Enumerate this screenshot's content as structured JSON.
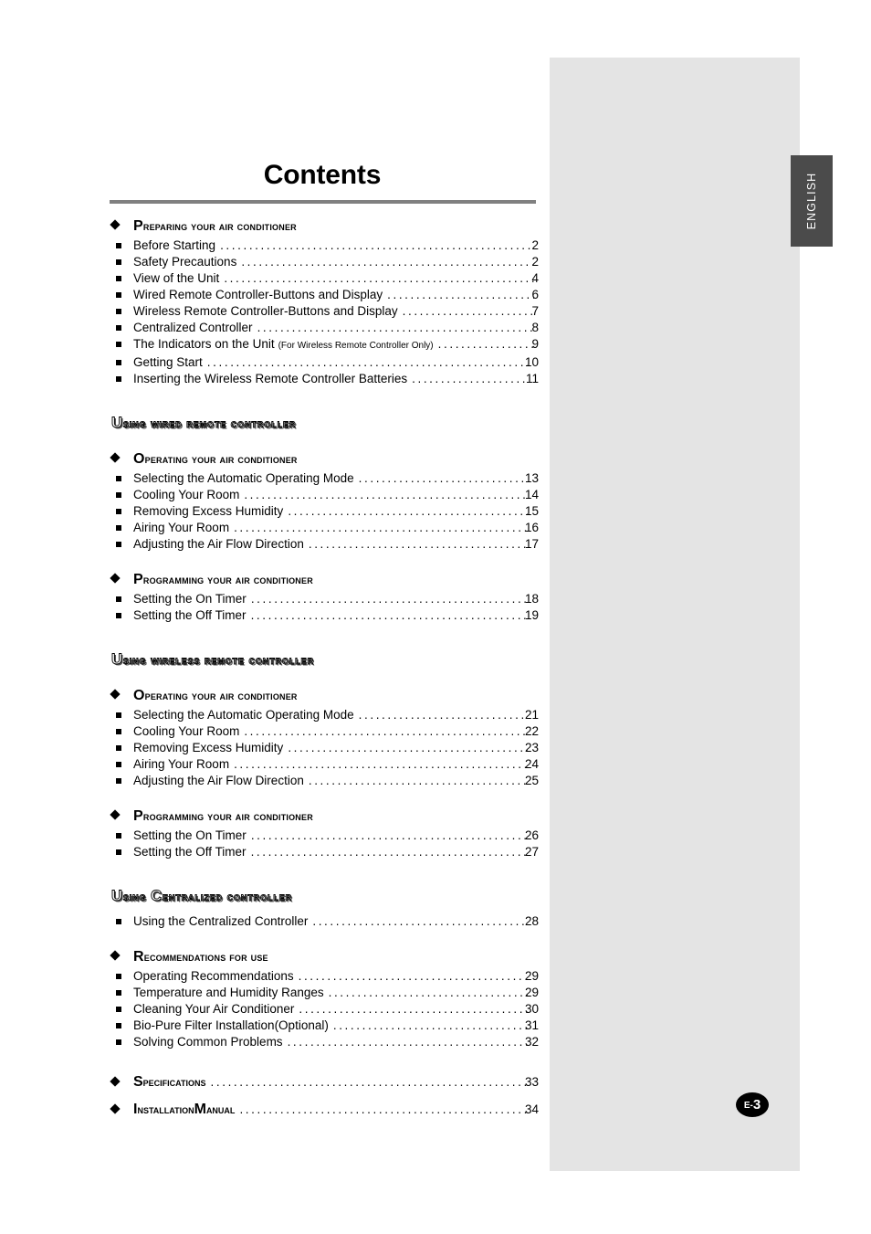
{
  "page": {
    "title": "Contents",
    "language_tab": "ENGLISH",
    "page_badge_prefix": "E-",
    "page_badge_number": "3",
    "accent_gray": "#e4e4e4",
    "tab_gray": "#4b4b4b",
    "rule_gray": "#808080"
  },
  "blocks": [
    {
      "kind": "section",
      "heading_lead": "P",
      "heading_rest": "reparing your air conditioner",
      "entries": [
        {
          "title": "Before Starting",
          "note": "",
          "page": "2"
        },
        {
          "title": "Safety Precautions",
          "note": "",
          "page": "2"
        },
        {
          "title": "View of the Unit",
          "note": "",
          "page": "4"
        },
        {
          "title": "Wired Remote Controller-Buttons and Display",
          "note": "",
          "page": "6"
        },
        {
          "title": "Wireless Remote Controller-Buttons and Display",
          "note": "",
          "page": "7"
        },
        {
          "title": "Centralized Controller",
          "note": "",
          "page": "8"
        },
        {
          "title": "The Indicators on the Unit",
          "note": "(For Wireless Remote Controller Only)",
          "page": "9"
        },
        {
          "title": "Getting Start",
          "note": "",
          "page": "10"
        },
        {
          "title": "Inserting the Wireless Remote Controller Batteries",
          "note": "",
          "page": "11"
        }
      ]
    },
    {
      "kind": "banner",
      "banner_lead": "U",
      "banner_rest": "sing wired remote controller"
    },
    {
      "kind": "section",
      "heading_lead": "O",
      "heading_rest": "perating your air conditioner",
      "entries": [
        {
          "title": "Selecting the Automatic Operating Mode",
          "note": "",
          "page": "13"
        },
        {
          "title": "Cooling Your Room",
          "note": "",
          "page": "14"
        },
        {
          "title": "Removing Excess Humidity",
          "note": "",
          "page": "15"
        },
        {
          "title": "Airing Your Room",
          "note": "",
          "page": "16"
        },
        {
          "title": "Adjusting the Air Flow Direction",
          "note": "",
          "page": "17"
        }
      ]
    },
    {
      "kind": "section",
      "heading_lead": "P",
      "heading_rest": "rogramming your air conditioner",
      "entries": [
        {
          "title": "Setting the On Timer",
          "note": "",
          "page": "18"
        },
        {
          "title": "Setting the Off Timer",
          "note": "",
          "page": "19"
        }
      ]
    },
    {
      "kind": "banner",
      "banner_lead": "U",
      "banner_rest": "sing wireless remote controller"
    },
    {
      "kind": "section",
      "heading_lead": "O",
      "heading_rest": "perating your air conditioner",
      "entries": [
        {
          "title": "Selecting the Automatic Operating Mode",
          "note": "",
          "page": "21"
        },
        {
          "title": "Cooling Your Room",
          "note": "",
          "page": "22"
        },
        {
          "title": "Removing Excess Humidity",
          "note": "",
          "page": "23"
        },
        {
          "title": "Airing Your Room",
          "note": "",
          "page": "24"
        },
        {
          "title": "Adjusting the Air Flow Direction",
          "note": "",
          "page": "25"
        }
      ]
    },
    {
      "kind": "section",
      "heading_lead": "P",
      "heading_rest": "rogramming your air conditioner",
      "entries": [
        {
          "title": "Setting the On Timer",
          "note": "",
          "page": "26"
        },
        {
          "title": "Setting the Off Timer",
          "note": "",
          "page": "27"
        }
      ]
    },
    {
      "kind": "banner-with-entries",
      "banner_lead": "U",
      "banner_mid": "sing ",
      "banner_cap2": "C",
      "banner_rest": "entralized controller",
      "entries": [
        {
          "title": "Using the Centralized Controller",
          "note": "",
          "page": "28"
        }
      ]
    },
    {
      "kind": "section",
      "heading_lead": "R",
      "heading_rest": "ecommendations for use",
      "entries": [
        {
          "title": "Operating Recommendations",
          "note": "",
          "page": "29"
        },
        {
          "title": "Temperature and Humidity Ranges",
          "note": "",
          "page": "29"
        },
        {
          "title": "Cleaning Your Air Conditioner",
          "note": "",
          "page": "30"
        },
        {
          "title": "Bio-Pure Filter Installation(Optional)",
          "note": "",
          "page": "31"
        },
        {
          "title": "Solving Common Problems",
          "note": "",
          "page": "32"
        }
      ]
    }
  ],
  "top_entries": [
    {
      "lead": "S",
      "rest": "pecifications",
      "page": "33"
    },
    {
      "lead": "I",
      "rest": "nstallation ",
      "lead2": "M",
      "rest2": "anual",
      "page": "34"
    }
  ]
}
